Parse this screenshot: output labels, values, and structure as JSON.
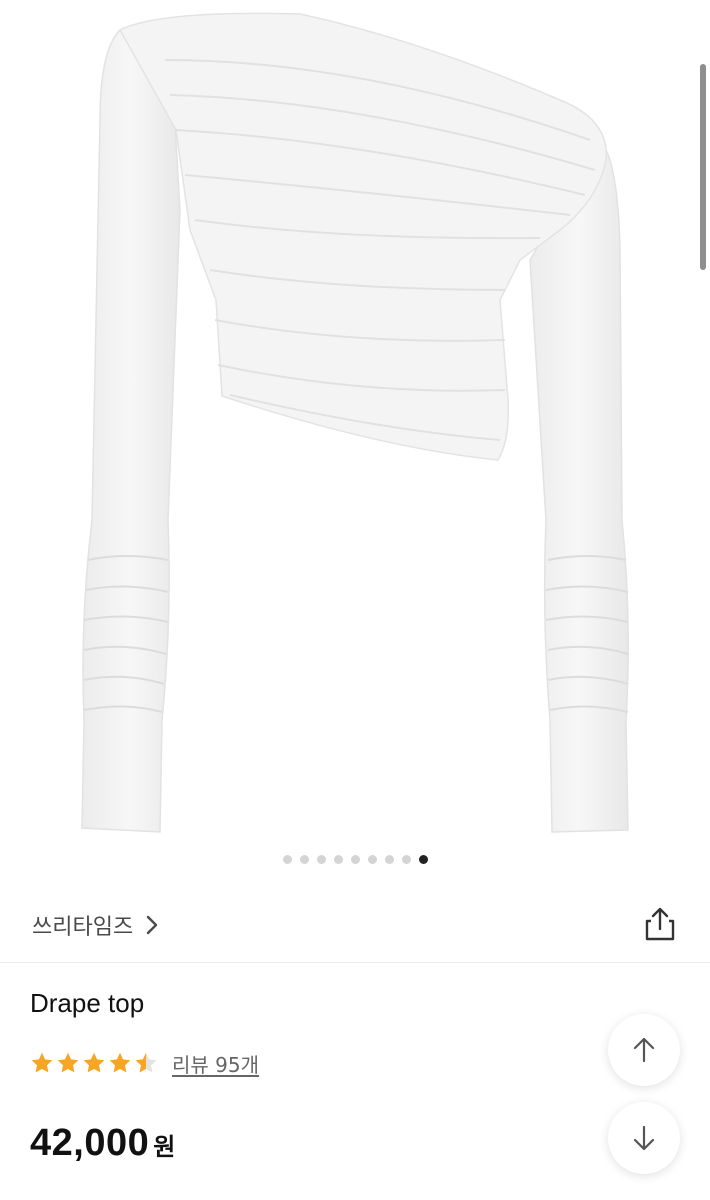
{
  "gallery": {
    "image_alt": "Drape top product photo",
    "total_slides": 9,
    "active_slide": 9
  },
  "brand": {
    "name": "쓰리타임즈",
    "chevron_icon": "chevron-right-icon"
  },
  "actions": {
    "share_icon": "share-icon",
    "scroll_up_icon": "arrow-up-icon",
    "scroll_down_icon": "arrow-down-icon"
  },
  "product": {
    "title": "Drape top",
    "rating": 4.5,
    "review_label": "리뷰 95개",
    "price": "42,000",
    "currency": "원"
  },
  "colors": {
    "star": "#f6a623",
    "active_dot": "#222222",
    "inactive_dot": "#d4d4d4"
  }
}
